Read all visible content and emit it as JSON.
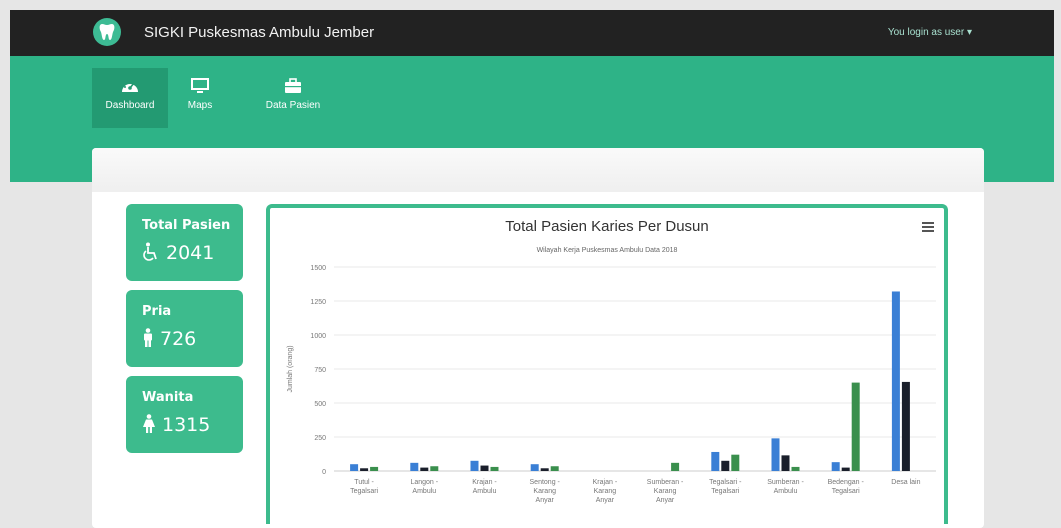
{
  "app": {
    "brand": "SIGKI Puskesmas Ambulu Jember",
    "user_link": "You login as user ▾"
  },
  "nav": [
    {
      "label": "Dashboard",
      "icon": "dashboard-icon",
      "active": true
    },
    {
      "label": "Maps",
      "icon": "monitor-icon",
      "active": false
    },
    {
      "label": "Data Pasien",
      "icon": "briefcase-icon",
      "active": false
    }
  ],
  "stats": [
    {
      "title": "Total Pasien",
      "value": "2041",
      "icon": "wheelchair-icon"
    },
    {
      "title": "Pria",
      "value": "726",
      "icon": "male-icon"
    },
    {
      "title": "Wanita",
      "value": "1315",
      "icon": "female-icon"
    }
  ],
  "colors": {
    "accent": "#2eb387",
    "series": [
      "#3a7fd5",
      "#1a1f2b",
      "#3a8f4d"
    ]
  },
  "chart_data": {
    "type": "bar",
    "title": "Total Pasien Karies Per Dusun",
    "subtitle": "Wilayah Kerja Puskesmas Ambulu Data 2018",
    "ylabel": "Jumlah (orang)",
    "ylim": [
      0,
      1500
    ],
    "yticks": [
      "0",
      "250",
      "500",
      "750",
      "1000",
      "1250",
      "1500"
    ],
    "categories": [
      [
        "Tutul -",
        "Tegalsari"
      ],
      [
        "Langon -",
        "Ambulu"
      ],
      [
        "Krajan -",
        "Ambulu"
      ],
      [
        "Sentong -",
        "Karang",
        "Anyar"
      ],
      [
        "Krajan -",
        "Karang",
        "Anyar"
      ],
      [
        "Sumberan -",
        "Karang",
        "Anyar"
      ],
      [
        "Tegalsari -",
        "Tegalsari"
      ],
      [
        "Sumberan -",
        "Ambulu"
      ],
      [
        "Bedengan -",
        "Tegalsari"
      ],
      [
        "Desa lain"
      ]
    ],
    "series": [
      {
        "values": [
          50,
          60,
          75,
          50,
          0,
          0,
          140,
          240,
          65,
          1320
        ]
      },
      {
        "values": [
          20,
          25,
          40,
          20,
          0,
          0,
          75,
          115,
          25,
          655
        ]
      },
      {
        "values": [
          30,
          35,
          30,
          35,
          0,
          60,
          120,
          30,
          650,
          0
        ]
      }
    ]
  }
}
